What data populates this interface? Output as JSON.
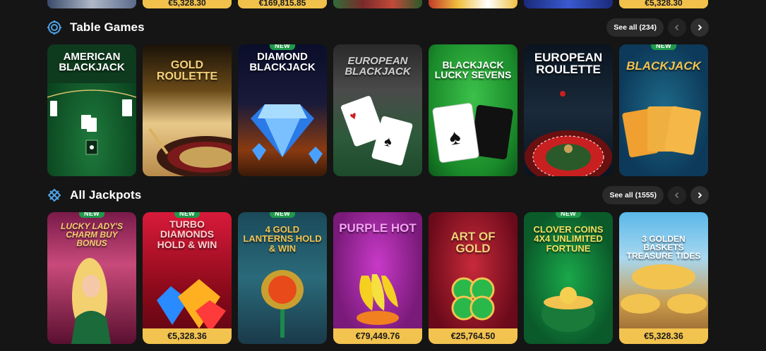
{
  "top_row": {
    "tiles": [
      {
        "jackpot": ""
      },
      {
        "jackpot": "€5,328.30"
      },
      {
        "jackpot": "€169,815.85"
      },
      {
        "jackpot": ""
      },
      {
        "jackpot": ""
      },
      {
        "jackpot": ""
      },
      {
        "jackpot": "€5,328.30"
      }
    ]
  },
  "table_games": {
    "title": "Table Games",
    "see_all": "See all (234)",
    "icon": "target-icon",
    "games": [
      {
        "title": "American Blackjack",
        "new": false
      },
      {
        "title": "Gold Roulette",
        "new": false
      },
      {
        "title": "Diamond Blackjack",
        "new": true
      },
      {
        "title": "European Blackjack",
        "new": false
      },
      {
        "title": "Blackjack Lucky Sevens",
        "new": false
      },
      {
        "title": "European Roulette",
        "new": false
      },
      {
        "title": "BlackJack",
        "new": true
      }
    ]
  },
  "all_jackpots": {
    "title": "All Jackpots",
    "see_all": "See all (1555)",
    "icon": "cross-diamond-icon",
    "games": [
      {
        "title": "Lucky Lady's Charm Buy Bonus",
        "new": true,
        "jackpot": ""
      },
      {
        "title": "Turbo Diamonds Hold & Win",
        "new": true,
        "jackpot": "€5,328.36"
      },
      {
        "title": "4 Gold Lanterns Hold & Win",
        "new": true,
        "jackpot": ""
      },
      {
        "title": "Purple Hot",
        "new": false,
        "jackpot": "€79,449.76"
      },
      {
        "title": "Art of Gold",
        "new": false,
        "jackpot": "€25,764.50"
      },
      {
        "title": "Clover Coins 4x4 Unlimited Fortune",
        "new": true,
        "jackpot": ""
      },
      {
        "title": "3 Golden Baskets Treasure Tides",
        "new": false,
        "jackpot": "€5,328.36"
      }
    ]
  },
  "labels": {
    "new_badge": "NEW"
  },
  "colors": {
    "background": "#151515",
    "jackpot_bar": "#f3c34f",
    "new_badge": "#1f9a4a",
    "icon_accent": "#4ea3e8"
  }
}
